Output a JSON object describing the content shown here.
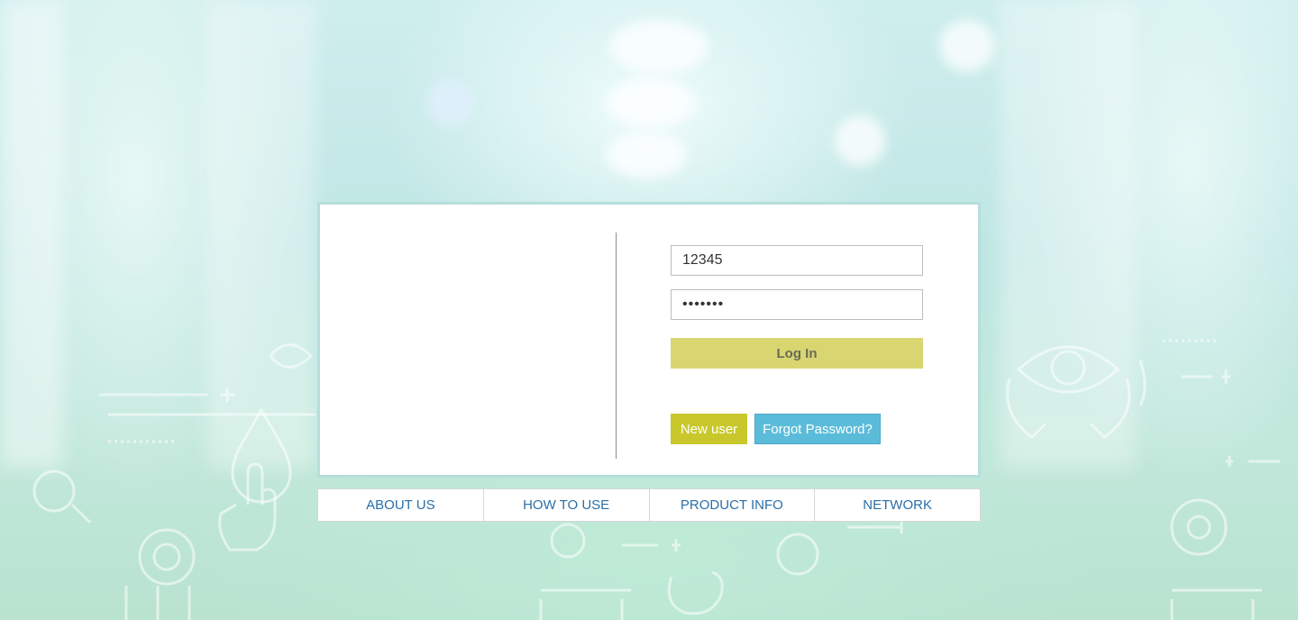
{
  "login": {
    "username_value": "12345",
    "password_value": "•••••••",
    "login_label": "Log In",
    "new_user_label": "New user",
    "forgot_password_label": "Forgot Password?"
  },
  "nav": {
    "items": [
      {
        "label": "ABOUT US"
      },
      {
        "label": "HOW TO USE"
      },
      {
        "label": "PRODUCT INFO"
      },
      {
        "label": "NETWORK"
      }
    ]
  },
  "colors": {
    "login_button": "#d9d672",
    "new_user_button": "#c8c82c",
    "forgot_button": "#5bbcd9",
    "nav_text": "#2a6fa8",
    "card_border": "#b6dedd"
  },
  "icons": [
    "eye-in-hands-icon",
    "drop-icon",
    "hand-icon",
    "stethoscope-icon",
    "gear-icon"
  ]
}
